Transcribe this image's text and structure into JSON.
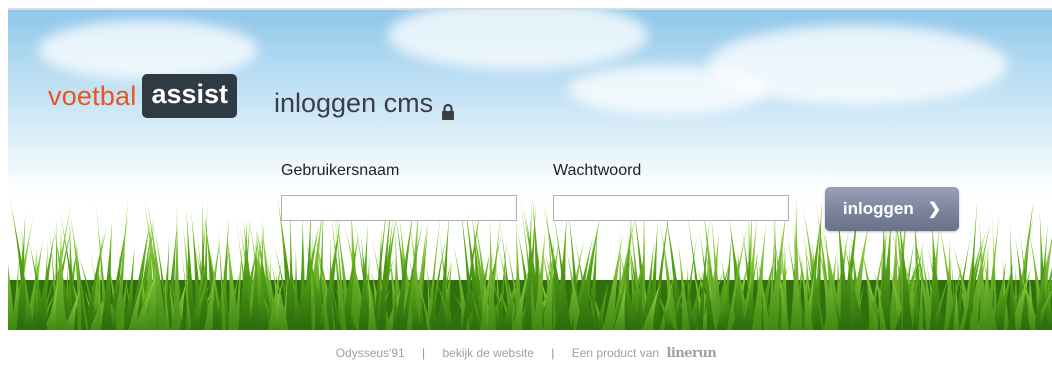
{
  "logo": {
    "word1": "voetbal",
    "word2": "assist"
  },
  "header": {
    "title": "inloggen cms",
    "lock_icon": "lock-icon"
  },
  "form": {
    "username_label": "Gebruikersnaam",
    "username_value": "",
    "password_label": "Wachtwoord",
    "password_value": "",
    "submit_label": "inloggen",
    "submit_icon": "chevron-right-icon"
  },
  "footer": {
    "club": "Odysseus'91",
    "separator": "|",
    "website_link": "bekijk de website",
    "product_text": "Een product van",
    "brand": "linerun"
  },
  "colors": {
    "logo_orange": "#e8561f",
    "logo_dark": "#2f3b42",
    "button": "#7b829c",
    "footer_text": "#9aa0a6"
  }
}
